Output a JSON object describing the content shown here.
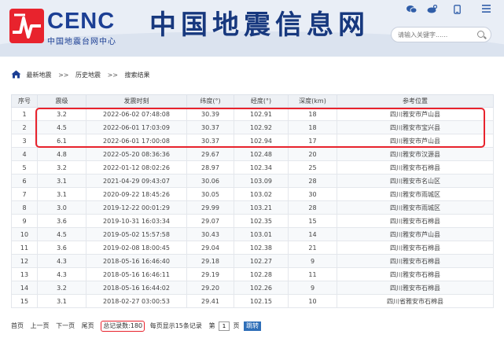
{
  "header": {
    "logo_text": "CENC",
    "logo_subtitle": "中国地震台网中心",
    "site_title": "中国地震信息网",
    "search_placeholder": "请输入关键字......",
    "top_icons": [
      "wechat-icon",
      "weibo-icon",
      "mobile-icon",
      "menu-icon"
    ]
  },
  "breadcrumb": {
    "items": [
      "最新地震",
      "历史地震",
      "搜索结果"
    ],
    "separator": ">>"
  },
  "table": {
    "columns": [
      "序号",
      "震级",
      "发震时刻",
      "纬度(°)",
      "经度(°)",
      "深度(km)",
      "参考位置"
    ],
    "rows": [
      [
        "1",
        "3.2",
        "2022-06-02 07:48:08",
        "30.39",
        "102.91",
        "18",
        "四川雅安市芦山县"
      ],
      [
        "2",
        "4.5",
        "2022-06-01 17:03:09",
        "30.37",
        "102.92",
        "18",
        "四川雅安市宝兴县"
      ],
      [
        "3",
        "6.1",
        "2022-06-01 17:00:08",
        "30.37",
        "102.94",
        "17",
        "四川雅安市芦山县"
      ],
      [
        "4",
        "4.8",
        "2022-05-20 08:36:36",
        "29.67",
        "102.48",
        "20",
        "四川雅安市汉源县"
      ],
      [
        "5",
        "3.2",
        "2022-01-12 08:02:26",
        "28.97",
        "102.34",
        "25",
        "四川雅安市石棉县"
      ],
      [
        "6",
        "3.1",
        "2021-04-29 09:43:07",
        "30.06",
        "103.09",
        "28",
        "四川雅安市名山区"
      ],
      [
        "7",
        "3.1",
        "2020-09-22 18:45:26",
        "30.05",
        "103.02",
        "30",
        "四川雅安市雨城区"
      ],
      [
        "8",
        "3.0",
        "2019-12-22 00:01:29",
        "29.99",
        "103.21",
        "28",
        "四川雅安市雨城区"
      ],
      [
        "9",
        "3.6",
        "2019-10-31 16:03:34",
        "29.07",
        "102.35",
        "15",
        "四川雅安市石棉县"
      ],
      [
        "10",
        "4.5",
        "2019-05-02 15:57:58",
        "30.43",
        "103.01",
        "14",
        "四川雅安市芦山县"
      ],
      [
        "11",
        "3.6",
        "2019-02-08 18:00:45",
        "29.04",
        "102.38",
        "21",
        "四川雅安市石棉县"
      ],
      [
        "12",
        "4.3",
        "2018-05-16 16:46:40",
        "29.18",
        "102.27",
        "9",
        "四川雅安市石棉县"
      ],
      [
        "13",
        "4.3",
        "2018-05-16 16:46:11",
        "29.19",
        "102.28",
        "11",
        "四川雅安市石棉县"
      ],
      [
        "14",
        "3.2",
        "2018-05-16 16:44:02",
        "29.20",
        "102.26",
        "9",
        "四川雅安市石棉县"
      ],
      [
        "15",
        "3.1",
        "2018-02-27 03:00:53",
        "29.41",
        "102.15",
        "10",
        "四川省雅安市石棉县"
      ]
    ]
  },
  "pager": {
    "first": "首页",
    "prev": "上一页",
    "next": "下一页",
    "last": "尾页",
    "total": "总记录数:180",
    "per_page": "每页显示15条记录",
    "page_prefix": "第",
    "page_value": "1",
    "page_suffix": "页",
    "jump": "跳转"
  },
  "colors": {
    "brand": "#1c3f94",
    "highlight": "#e8232d",
    "jump_button": "#2f6fb8"
  }
}
